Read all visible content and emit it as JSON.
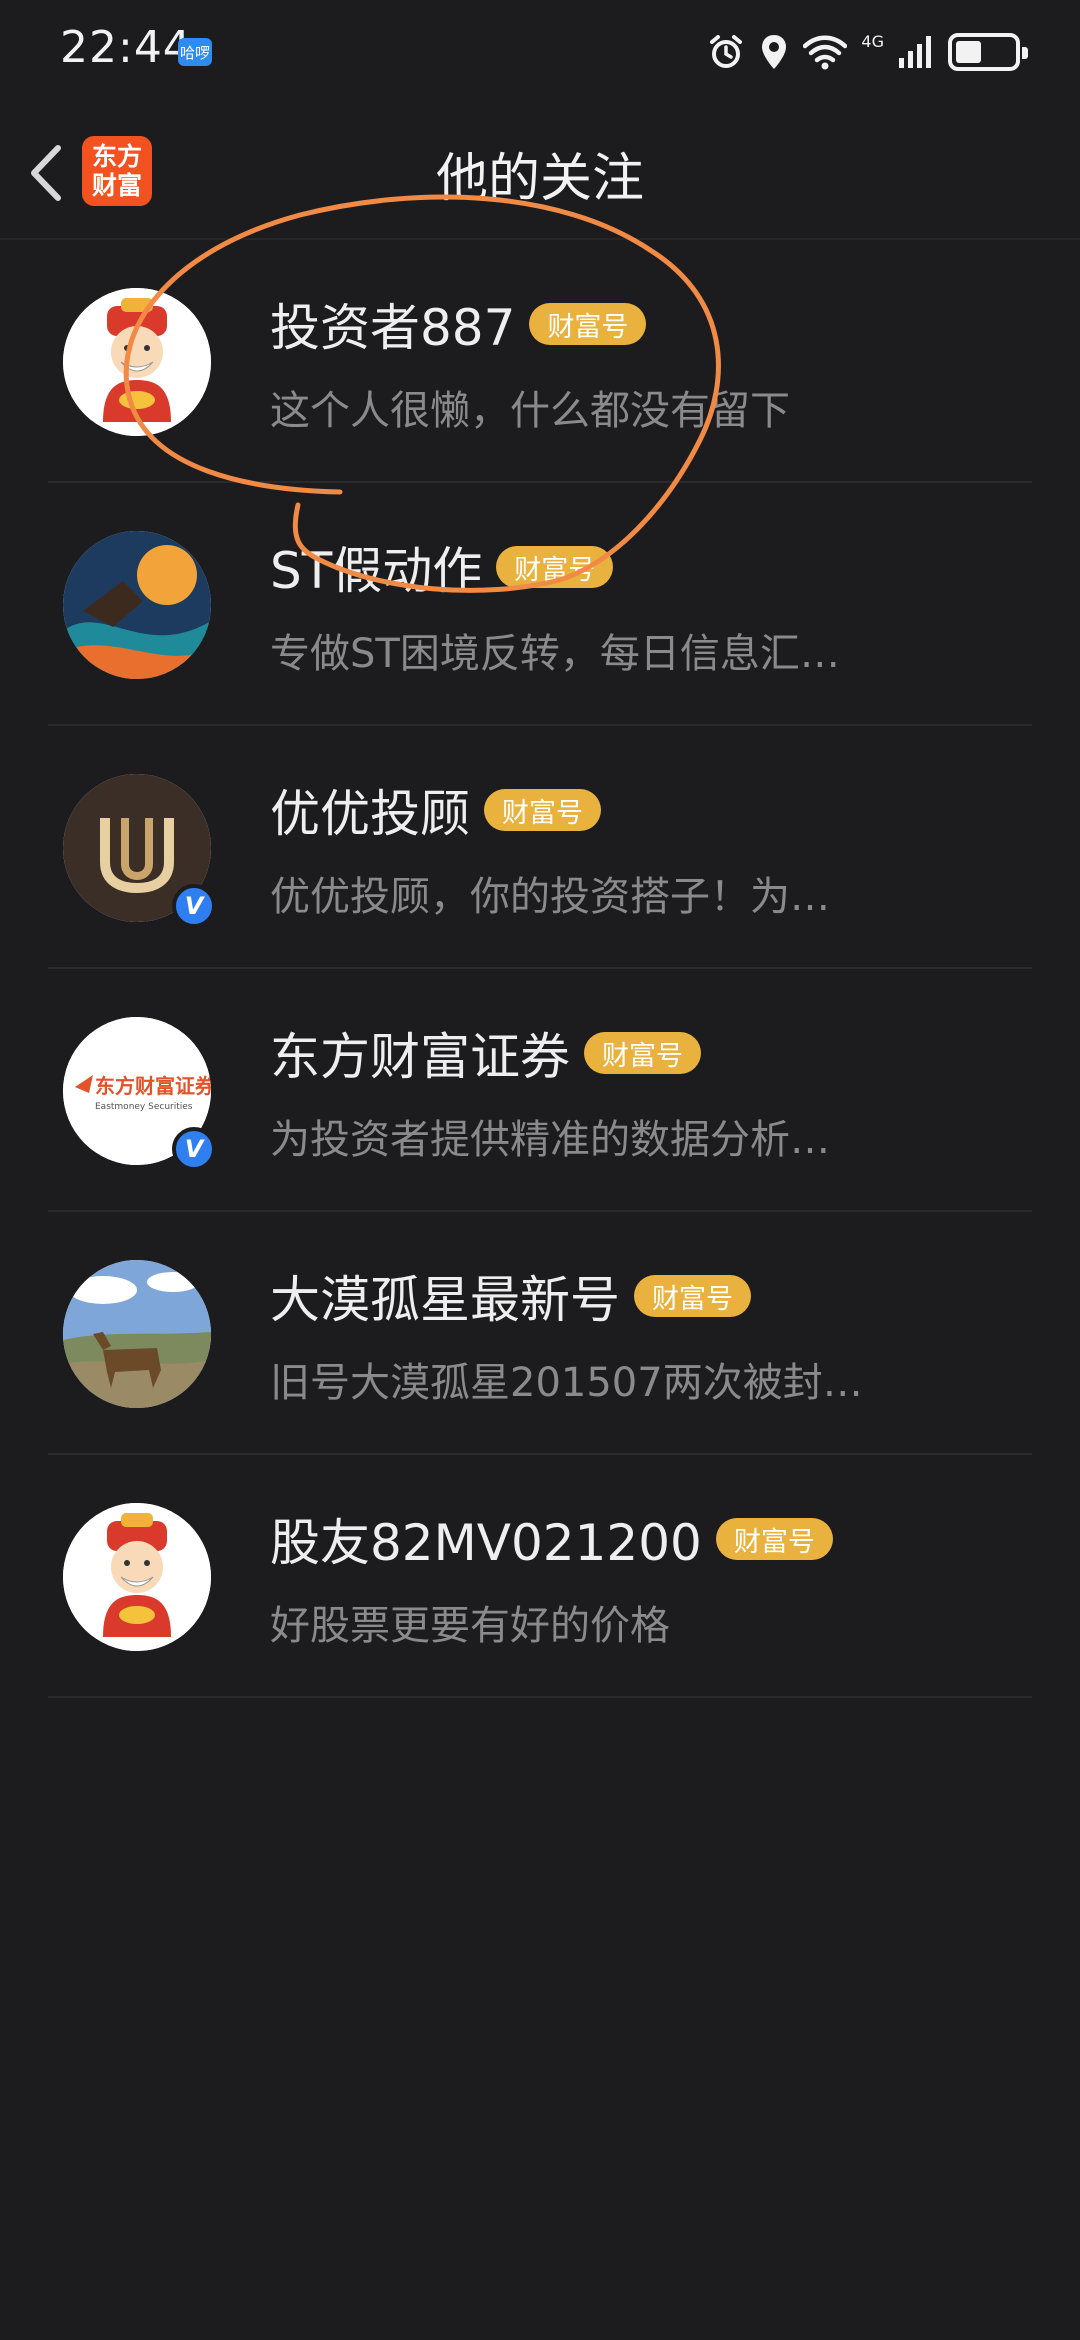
{
  "status_bar": {
    "time": "22:44",
    "app_badge": "哈啰",
    "network": "4G",
    "battery_level": 0.45
  },
  "nav": {
    "title": "他的关注",
    "brand_logo_line1": "东方",
    "brand_logo_line2": "财富"
  },
  "follows": [
    {
      "name": "投资者887",
      "badge": "财富号",
      "bio": "这个人很懒，什么都没有留下",
      "avatar": "god-of-wealth-avatar",
      "verified": false
    },
    {
      "name": "ST假动作",
      "badge": "财富号",
      "bio": "专做ST困境反转，每日信息汇…",
      "avatar": "fantasy-artwork-avatar",
      "verified": false
    },
    {
      "name": "优优投顾",
      "badge": "财富号",
      "bio": "优优投顾，你的投资搭子！为…",
      "avatar": "uu-logo-avatar",
      "verified": true
    },
    {
      "name": "东方财富证券",
      "badge": "财富号",
      "bio": "为投资者提供精准的数据分析…",
      "avatar": "eastmoney-securities-logo",
      "verified": true,
      "logo_text": "东方财富证券",
      "logo_subtext": "Eastmoney Securities"
    },
    {
      "name": "大漠孤星最新号",
      "badge": "财富号",
      "bio": "旧号大漠孤星201507两次被封…",
      "avatar": "horse-landscape-photo",
      "verified": false
    },
    {
      "name": "股友82MV021200",
      "badge": "财富号",
      "bio": "好股票更要有好的价格",
      "avatar": "god-of-wealth-avatar",
      "verified": false
    }
  ],
  "colors": {
    "background": "#1c1c1e",
    "badge": "#e9b23f",
    "brand": "#f1521f",
    "verified": "#2f7ff0",
    "annotation": "#f08a45"
  },
  "verified_mark": "V"
}
